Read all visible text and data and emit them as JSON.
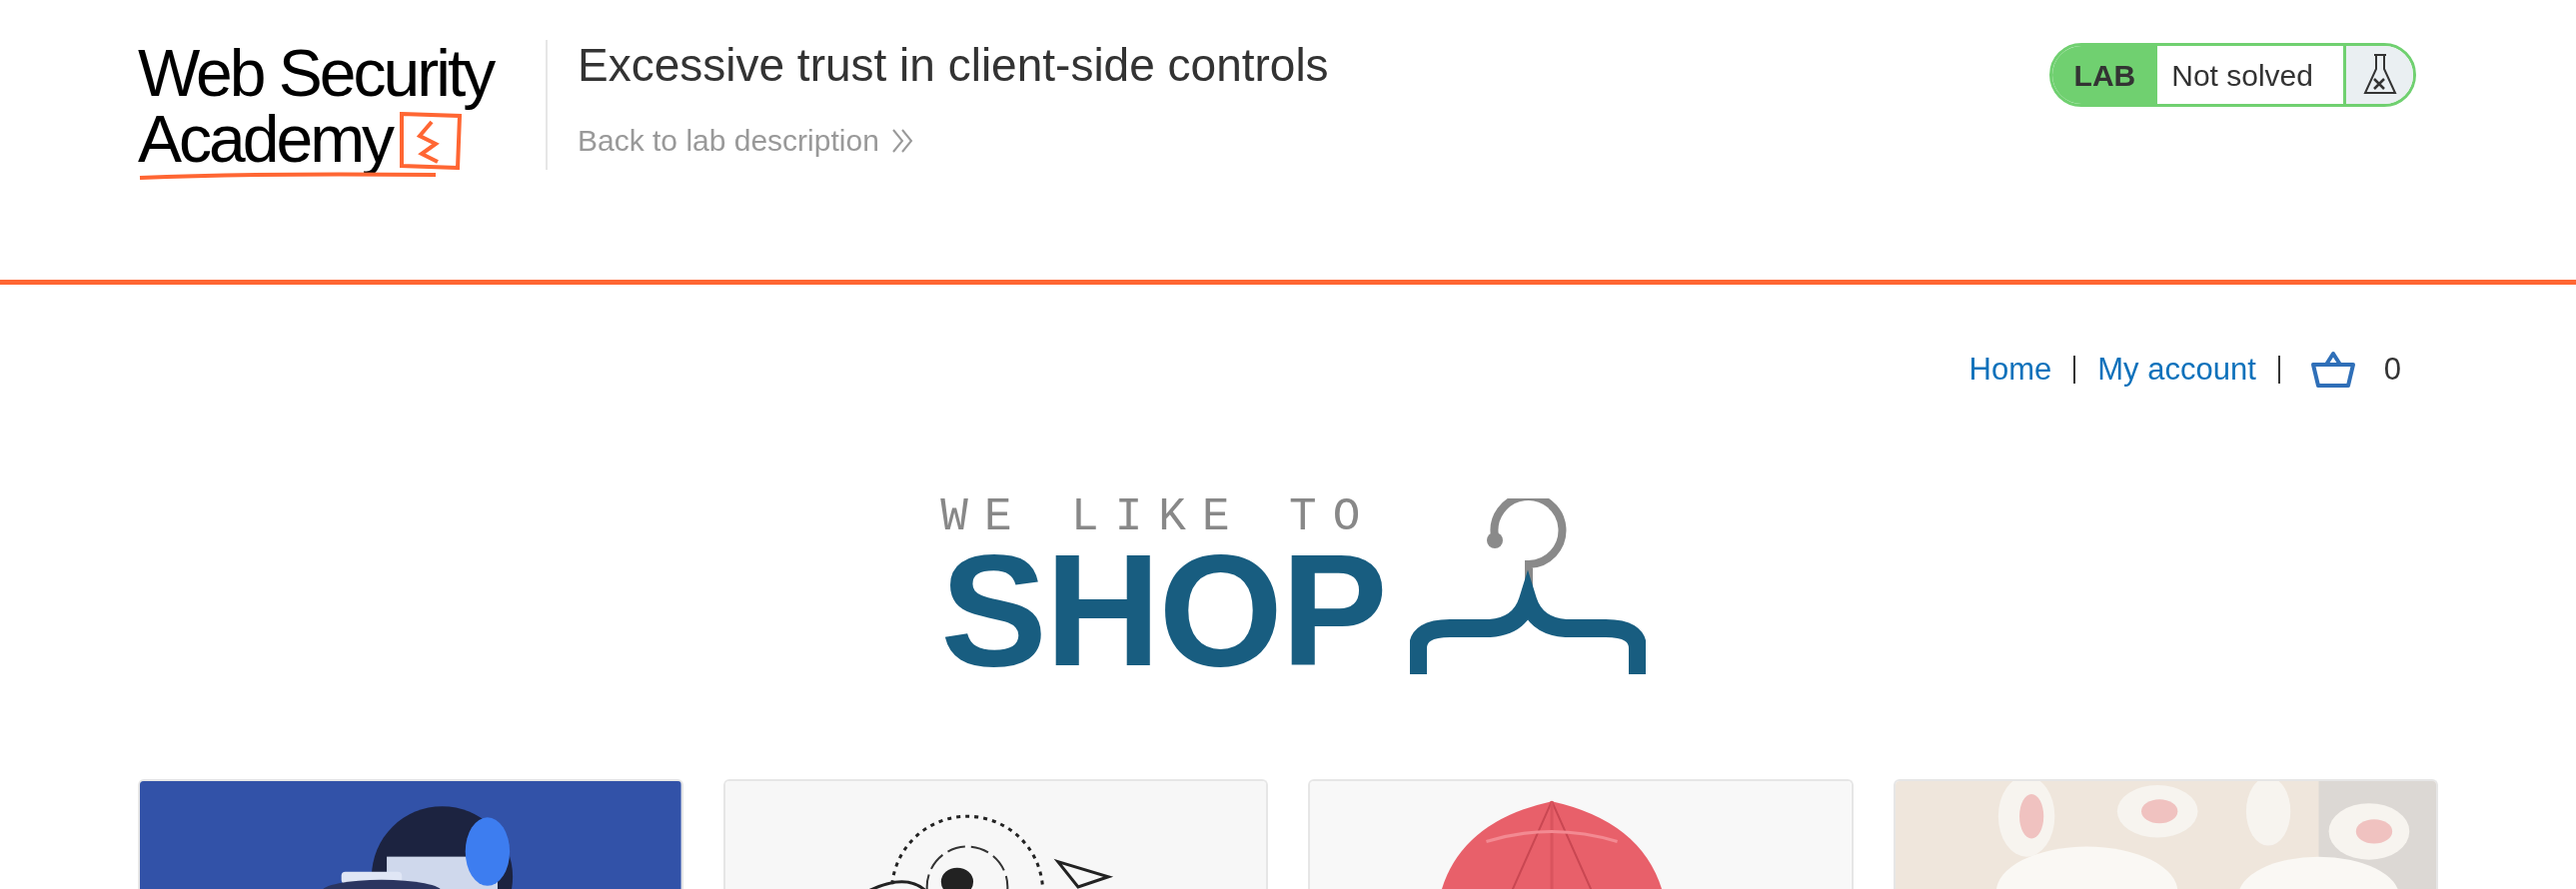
{
  "academy_logo": {
    "line_1": "Web Security",
    "line_2": "Academy"
  },
  "lab": {
    "title": "Excessive trust in client-side controls",
    "back_link": "Back to lab description",
    "badge_label": "LAB",
    "status": "Not solved"
  },
  "nav": {
    "links": [
      "Home",
      "My account"
    ],
    "cart_count": "0"
  },
  "shop_logo": {
    "tagline": "WE LIKE TO",
    "word": "SHOP"
  }
}
